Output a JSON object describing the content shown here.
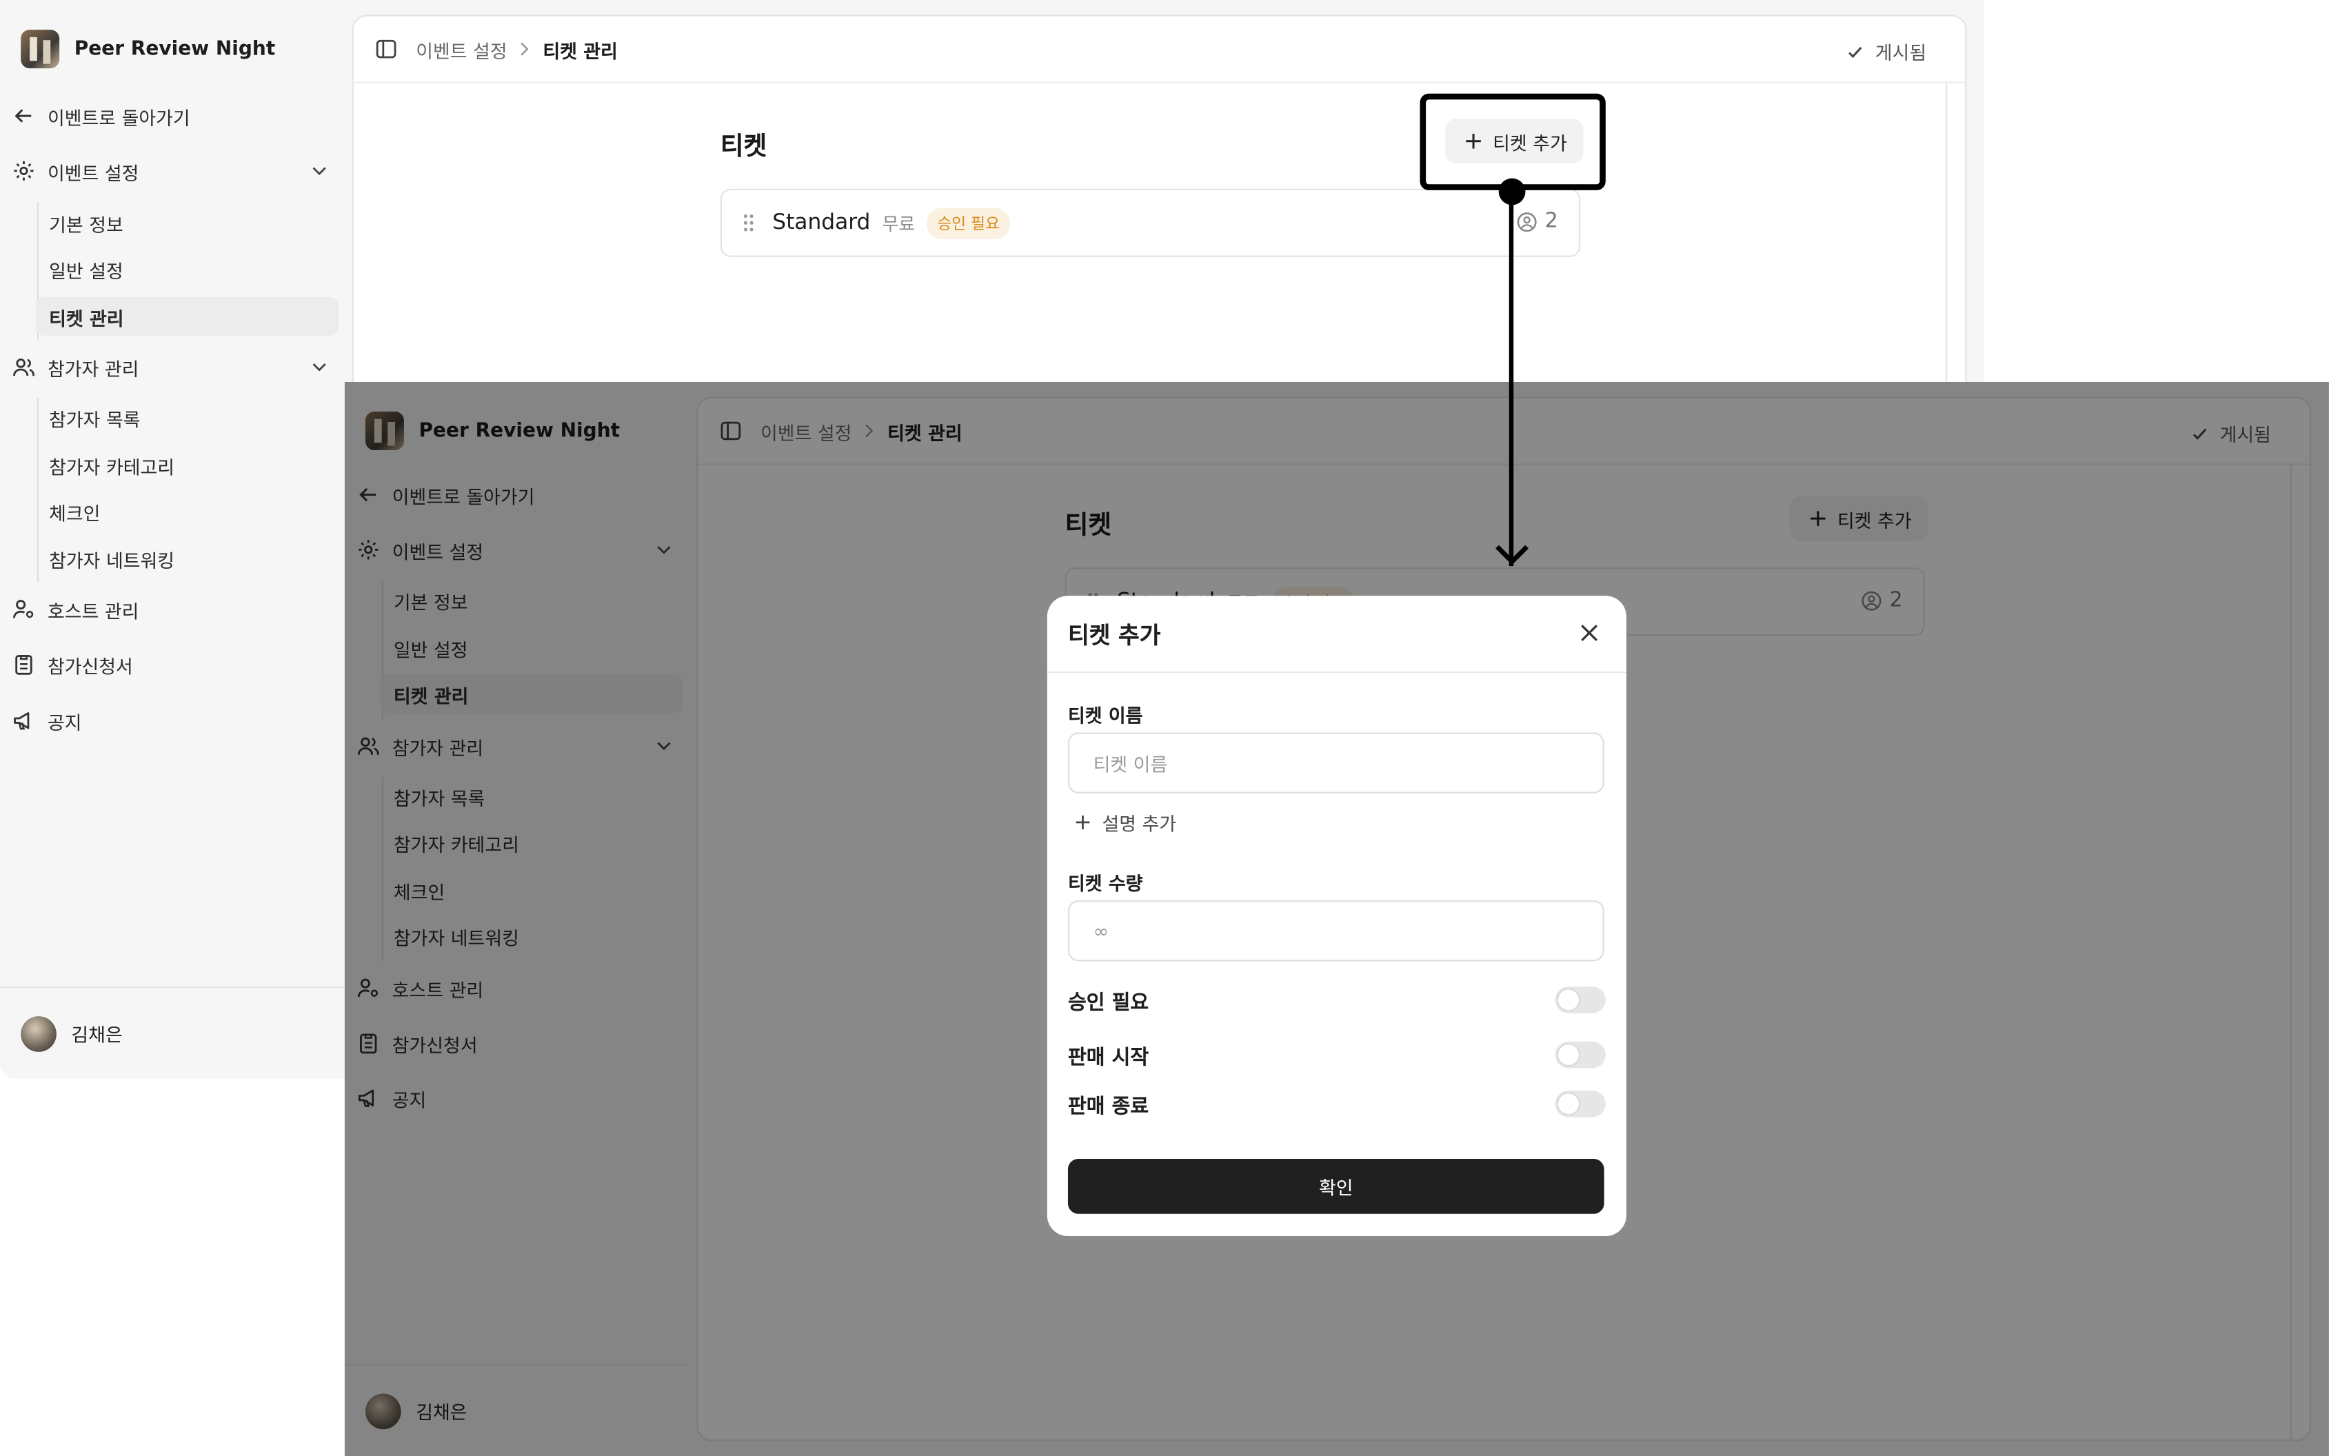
{
  "app": {
    "name": "Peer Review Night",
    "back_label": "이벤트로 돌아가기",
    "user_name": "김채은"
  },
  "sidebar": {
    "groups": [
      {
        "label": "이벤트 설정",
        "items": [
          "기본 정보",
          "일반 설정",
          "티켓 관리"
        ]
      },
      {
        "label": "참가자 관리",
        "items": [
          "참가자 목록",
          "참가자 카테고리",
          "체크인",
          "참가자 네트워킹"
        ]
      }
    ],
    "links": [
      "호스트 관리",
      "참가신청서",
      "공지"
    ]
  },
  "topbar": {
    "crumb_parent": "이벤트 설정",
    "crumb_current": "티켓 관리",
    "status": "게시됨"
  },
  "tickets": {
    "title": "티켓",
    "add_label": "티켓 추가",
    "rows": [
      {
        "name": "Standard",
        "price": "무료",
        "badge": "승인 필요",
        "count": "2"
      }
    ]
  },
  "modal": {
    "title": "티켓 추가",
    "name_label": "티켓 이름",
    "name_placeholder": "티켓 이름",
    "add_desc": "설명 추가",
    "qty_label": "티켓 수량",
    "qty_placeholder": "∞",
    "toggles": [
      {
        "label": "승인 필요",
        "on": false
      },
      {
        "label": "판매 시작",
        "on": false
      },
      {
        "label": "판매 종료",
        "on": false
      }
    ],
    "confirm": "확인"
  },
  "colors": {
    "badge_text": "#d98a1b",
    "badge_bg": "#fbf1e1",
    "confirm_bg": "#202020",
    "overlay": "rgba(0,0,0,0.46)"
  }
}
